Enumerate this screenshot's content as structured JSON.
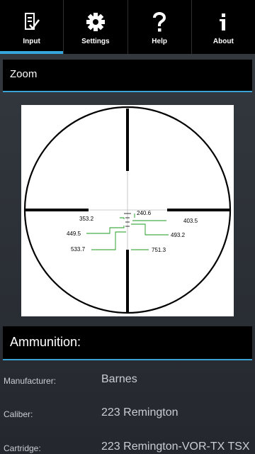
{
  "tabs": [
    {
      "label": "Input",
      "icon": "input-checklist-icon",
      "active": true
    },
    {
      "label": "Settings",
      "icon": "gear-icon",
      "active": false
    },
    {
      "label": "Help",
      "icon": "question-icon",
      "active": false
    },
    {
      "label": "About",
      "icon": "info-icon",
      "active": false
    }
  ],
  "zoom": {
    "title": "Zoom"
  },
  "reticle": {
    "labels": [
      "240.6",
      "403.5",
      "353.2",
      "493.2",
      "449.5",
      "533.7",
      "751.3"
    ]
  },
  "ammunition": {
    "title": "Ammunition:",
    "rows": [
      {
        "key": "Manufacturer:",
        "value": "Barnes"
      },
      {
        "key": "Caliber:",
        "value": "223 Remington"
      },
      {
        "key": "Cartridge:",
        "value": "223 Remington-VOR-TX TSX"
      }
    ]
  },
  "colors": {
    "accent": "#35a7dd",
    "header_bg": "#000000",
    "mark_line": "#1a9a1a"
  }
}
